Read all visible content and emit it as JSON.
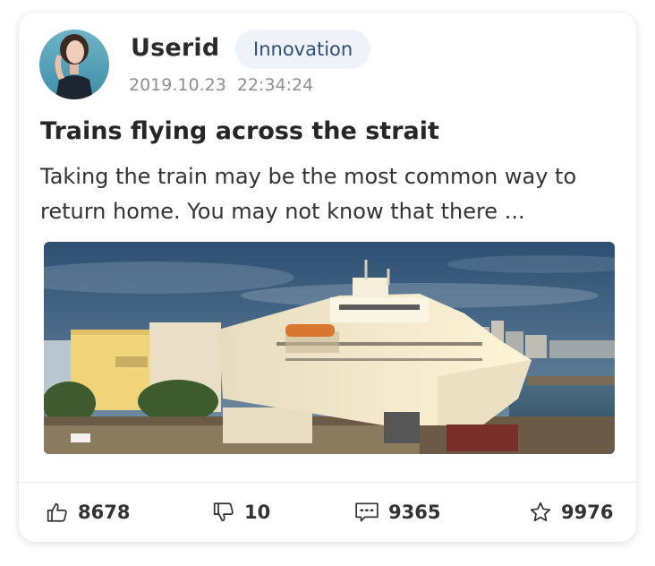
{
  "post": {
    "username": "Userid",
    "category_tag": "Innovation",
    "timestamp": "2019.10.23  22:34:24",
    "title": "Trains flying across the strait",
    "excerpt": "Taking the train may be the most common way to return home. You may not know that there ..."
  },
  "actions": {
    "likes": "8678",
    "dislikes": "10",
    "comments": "9365",
    "favorites": "9976"
  },
  "icons": {
    "like": "thumbs-up-icon",
    "dislike": "thumbs-down-icon",
    "comment": "comment-icon",
    "favorite": "star-icon"
  },
  "colors": {
    "tag_background": "#eef2f9",
    "tag_text": "#2f4f75",
    "timestamp": "#8f8f8f"
  }
}
